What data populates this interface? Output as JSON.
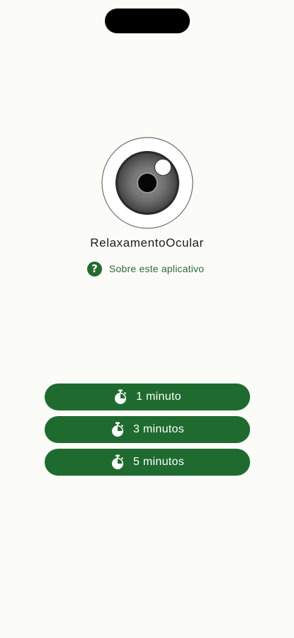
{
  "app": {
    "name": "RelaxamentoOcular"
  },
  "about": {
    "label": "Sobre este aplicativo",
    "icon": "help-circle-icon",
    "icon_glyph": "?"
  },
  "timers": [
    {
      "label": "1 minuto",
      "icon": "stopwatch-icon"
    },
    {
      "label": "3 minutos",
      "icon": "stopwatch-icon"
    },
    {
      "label": "5 minutos",
      "icon": "stopwatch-icon"
    }
  ],
  "colors": {
    "accent": "#1f6b2f",
    "background": "#fbfcf8",
    "text": "#1b1b1b"
  }
}
